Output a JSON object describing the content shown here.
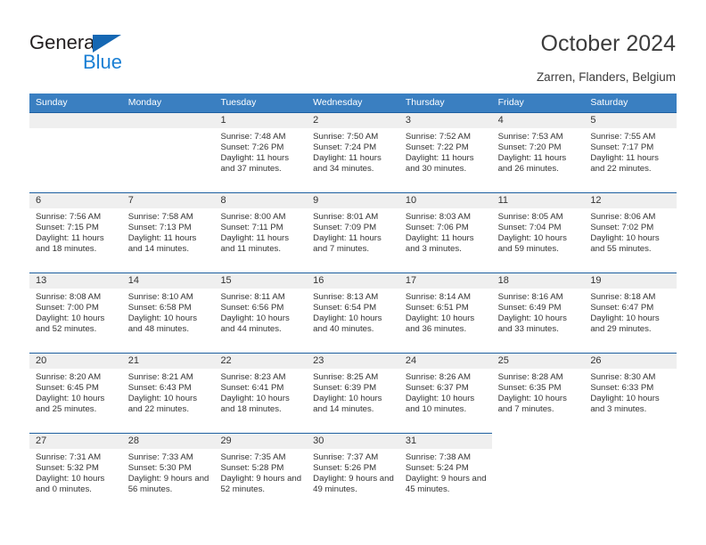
{
  "brand": {
    "name_top": "General",
    "name_bottom": "Blue",
    "triangle_color": "#1567b3",
    "blue_color": "#1a7fd4"
  },
  "header": {
    "title": "October 2024",
    "subtitle": "Zarren, Flanders, Belgium"
  },
  "calendar": {
    "header_bg": "#3a7fc1",
    "row_border": "#1d5fa0",
    "daynum_bg": "#efefef",
    "weekdays": [
      "Sunday",
      "Monday",
      "Tuesday",
      "Wednesday",
      "Thursday",
      "Friday",
      "Saturday"
    ],
    "weeks": [
      [
        {
          "blank": true
        },
        {
          "blank": true
        },
        {
          "day": "1",
          "sunrise": "Sunrise: 7:48 AM",
          "sunset": "Sunset: 7:26 PM",
          "daylight": "Daylight: 11 hours and 37 minutes."
        },
        {
          "day": "2",
          "sunrise": "Sunrise: 7:50 AM",
          "sunset": "Sunset: 7:24 PM",
          "daylight": "Daylight: 11 hours and 34 minutes."
        },
        {
          "day": "3",
          "sunrise": "Sunrise: 7:52 AM",
          "sunset": "Sunset: 7:22 PM",
          "daylight": "Daylight: 11 hours and 30 minutes."
        },
        {
          "day": "4",
          "sunrise": "Sunrise: 7:53 AM",
          "sunset": "Sunset: 7:20 PM",
          "daylight": "Daylight: 11 hours and 26 minutes."
        },
        {
          "day": "5",
          "sunrise": "Sunrise: 7:55 AM",
          "sunset": "Sunset: 7:17 PM",
          "daylight": "Daylight: 11 hours and 22 minutes."
        }
      ],
      [
        {
          "day": "6",
          "sunrise": "Sunrise: 7:56 AM",
          "sunset": "Sunset: 7:15 PM",
          "daylight": "Daylight: 11 hours and 18 minutes."
        },
        {
          "day": "7",
          "sunrise": "Sunrise: 7:58 AM",
          "sunset": "Sunset: 7:13 PM",
          "daylight": "Daylight: 11 hours and 14 minutes."
        },
        {
          "day": "8",
          "sunrise": "Sunrise: 8:00 AM",
          "sunset": "Sunset: 7:11 PM",
          "daylight": "Daylight: 11 hours and 11 minutes."
        },
        {
          "day": "9",
          "sunrise": "Sunrise: 8:01 AM",
          "sunset": "Sunset: 7:09 PM",
          "daylight": "Daylight: 11 hours and 7 minutes."
        },
        {
          "day": "10",
          "sunrise": "Sunrise: 8:03 AM",
          "sunset": "Sunset: 7:06 PM",
          "daylight": "Daylight: 11 hours and 3 minutes."
        },
        {
          "day": "11",
          "sunrise": "Sunrise: 8:05 AM",
          "sunset": "Sunset: 7:04 PM",
          "daylight": "Daylight: 10 hours and 59 minutes."
        },
        {
          "day": "12",
          "sunrise": "Sunrise: 8:06 AM",
          "sunset": "Sunset: 7:02 PM",
          "daylight": "Daylight: 10 hours and 55 minutes."
        }
      ],
      [
        {
          "day": "13",
          "sunrise": "Sunrise: 8:08 AM",
          "sunset": "Sunset: 7:00 PM",
          "daylight": "Daylight: 10 hours and 52 minutes."
        },
        {
          "day": "14",
          "sunrise": "Sunrise: 8:10 AM",
          "sunset": "Sunset: 6:58 PM",
          "daylight": "Daylight: 10 hours and 48 minutes."
        },
        {
          "day": "15",
          "sunrise": "Sunrise: 8:11 AM",
          "sunset": "Sunset: 6:56 PM",
          "daylight": "Daylight: 10 hours and 44 minutes."
        },
        {
          "day": "16",
          "sunrise": "Sunrise: 8:13 AM",
          "sunset": "Sunset: 6:54 PM",
          "daylight": "Daylight: 10 hours and 40 minutes."
        },
        {
          "day": "17",
          "sunrise": "Sunrise: 8:14 AM",
          "sunset": "Sunset: 6:51 PM",
          "daylight": "Daylight: 10 hours and 36 minutes."
        },
        {
          "day": "18",
          "sunrise": "Sunrise: 8:16 AM",
          "sunset": "Sunset: 6:49 PM",
          "daylight": "Daylight: 10 hours and 33 minutes."
        },
        {
          "day": "19",
          "sunrise": "Sunrise: 8:18 AM",
          "sunset": "Sunset: 6:47 PM",
          "daylight": "Daylight: 10 hours and 29 minutes."
        }
      ],
      [
        {
          "day": "20",
          "sunrise": "Sunrise: 8:20 AM",
          "sunset": "Sunset: 6:45 PM",
          "daylight": "Daylight: 10 hours and 25 minutes."
        },
        {
          "day": "21",
          "sunrise": "Sunrise: 8:21 AM",
          "sunset": "Sunset: 6:43 PM",
          "daylight": "Daylight: 10 hours and 22 minutes."
        },
        {
          "day": "22",
          "sunrise": "Sunrise: 8:23 AM",
          "sunset": "Sunset: 6:41 PM",
          "daylight": "Daylight: 10 hours and 18 minutes."
        },
        {
          "day": "23",
          "sunrise": "Sunrise: 8:25 AM",
          "sunset": "Sunset: 6:39 PM",
          "daylight": "Daylight: 10 hours and 14 minutes."
        },
        {
          "day": "24",
          "sunrise": "Sunrise: 8:26 AM",
          "sunset": "Sunset: 6:37 PM",
          "daylight": "Daylight: 10 hours and 10 minutes."
        },
        {
          "day": "25",
          "sunrise": "Sunrise: 8:28 AM",
          "sunset": "Sunset: 6:35 PM",
          "daylight": "Daylight: 10 hours and 7 minutes."
        },
        {
          "day": "26",
          "sunrise": "Sunrise: 8:30 AM",
          "sunset": "Sunset: 6:33 PM",
          "daylight": "Daylight: 10 hours and 3 minutes."
        }
      ],
      [
        {
          "day": "27",
          "sunrise": "Sunrise: 7:31 AM",
          "sunset": "Sunset: 5:32 PM",
          "daylight": "Daylight: 10 hours and 0 minutes."
        },
        {
          "day": "28",
          "sunrise": "Sunrise: 7:33 AM",
          "sunset": "Sunset: 5:30 PM",
          "daylight": "Daylight: 9 hours and 56 minutes."
        },
        {
          "day": "29",
          "sunrise": "Sunrise: 7:35 AM",
          "sunset": "Sunset: 5:28 PM",
          "daylight": "Daylight: 9 hours and 52 minutes."
        },
        {
          "day": "30",
          "sunrise": "Sunrise: 7:37 AM",
          "sunset": "Sunset: 5:26 PM",
          "daylight": "Daylight: 9 hours and 49 minutes."
        },
        {
          "day": "31",
          "sunrise": "Sunrise: 7:38 AM",
          "sunset": "Sunset: 5:24 PM",
          "daylight": "Daylight: 9 hours and 45 minutes."
        },
        {
          "blank": true
        },
        {
          "blank": true
        }
      ]
    ]
  }
}
